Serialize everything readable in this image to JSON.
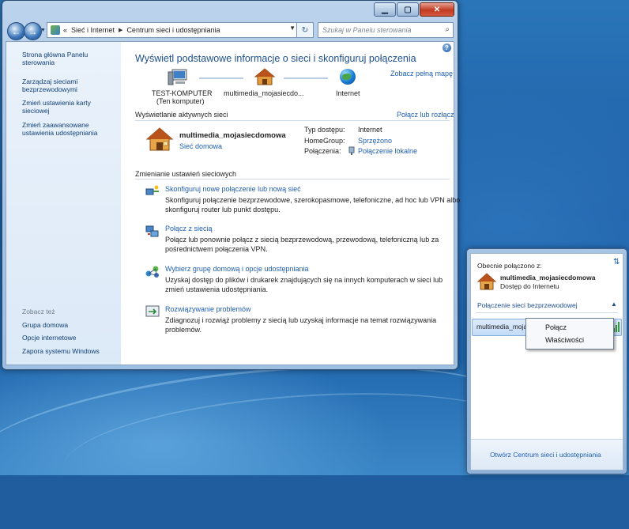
{
  "window": {
    "caption_buttons": [
      "minimize",
      "maximize",
      "close"
    ],
    "address": {
      "crumbs": [
        "Sieć i Internet",
        "Centrum sieci i udostępniania"
      ],
      "back_glyph": "«",
      "search_placeholder": "Szukaj w Panelu sterowania"
    },
    "left_pane": {
      "links": [
        "Strona główna Panelu sterowania",
        "Zarządzaj sieciami bezprzewodowymi",
        "Zmień ustawienia karty sieciowej",
        "Zmień zaawansowane ustawienia udostępniania"
      ],
      "see_also_heading": "Zobacz też",
      "see_also": [
        "Grupa domowa",
        "Opcje internetowe",
        "Zapora systemu Windows"
      ]
    },
    "main": {
      "title": "Wyświetl podstawowe informacje o sieci i skonfiguruj połączenia",
      "full_map_link": "Zobacz pełną mapę",
      "map": {
        "computer_name": "TEST-KOMPUTER",
        "computer_sub": "(Ten komputer)",
        "network_name": "multimedia_mojasiecdo...",
        "internet": "Internet"
      },
      "active_heading": "Wyświetlanie aktywnych sieci",
      "connect_link": "Połącz lub rozłącz",
      "active_network": {
        "name": "multimedia_mojasiecdomowa",
        "type_link": "Sieć domowa",
        "access_label": "Typ dostępu:",
        "access_value": "Internet",
        "homegroup_label": "HomeGroup:",
        "homegroup_value": "Sprzężono",
        "connections_label": "Połączenia:",
        "connections_value": "Połączenie lokalne"
      },
      "settings_heading": "Zmienianie ustawień sieciowych",
      "tasks": [
        {
          "title": "Skonfiguruj nowe połączenie lub nową sieć",
          "desc1": "Skonfiguruj połączenie bezprzewodowe, szerokopasmowe, telefoniczne, ad hoc lub VPN albo",
          "desc2": "skonfiguruj router lub punkt dostępu."
        },
        {
          "title": "Połącz z siecią",
          "desc1": "Połącz lub ponownie połącz z siecią bezprzewodową, przewodową, telefoniczną lub za",
          "desc2": "pośrednictwem połączenia VPN."
        },
        {
          "title": "Wybierz grupę domową i opcje udostępniania",
          "desc1": "Uzyskaj dostęp do plików i drukarek znajdujących się na innych komputerach w sieci lub",
          "desc2": "zmień ustawienia udostępniania."
        },
        {
          "title": "Rozwiązywanie problemów",
          "desc1": "Zdiagnozuj i rozwiąż problemy z siecią lub uzyskaj informacje na temat rozwiązywania",
          "desc2": "problemów."
        }
      ]
    }
  },
  "flyout": {
    "heading": "Obecnie połączono z:",
    "network_name": "multimedia_mojasiecdomowa",
    "network_status": "Dostęp do Internetu",
    "wireless_section": "Połączenie sieci bezprzewodowej",
    "selected_item": "multimedia_mojasiecd",
    "footer_link": "Otwórz Centrum sieci i udostępniania"
  },
  "context_menu": {
    "items": [
      "Połącz",
      "Właściwości"
    ]
  }
}
